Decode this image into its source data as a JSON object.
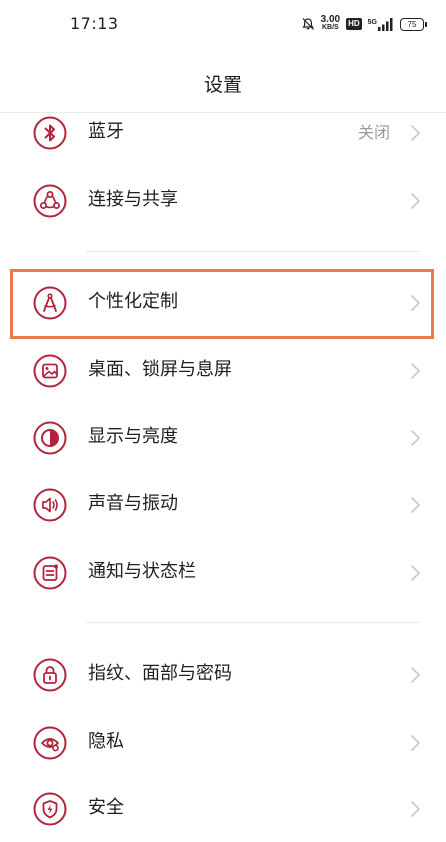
{
  "status_bar": {
    "time": "17:13",
    "net_speed_value": "3.00",
    "net_speed_unit": "KB/S",
    "hd_label": "HD",
    "network_label": "5G",
    "battery_level": "75"
  },
  "header": {
    "title": "设置"
  },
  "theme": {
    "accent": "#b3243c",
    "highlight_border": "#ee7a4c",
    "label_color": "#1f1f1f",
    "secondary_text": "#9a9a9a",
    "chevron_color": "#c8c8c8"
  },
  "settings": [
    {
      "label": "蓝牙",
      "value": "关闭",
      "icon": "bluetooth-icon"
    },
    {
      "label": "连接与共享",
      "value": "",
      "icon": "share-connections-icon"
    },
    {
      "label": "个性化定制",
      "value": "",
      "icon": "compass-personalize-icon",
      "highlighted": true
    },
    {
      "label": "桌面、锁屏与息屏",
      "value": "",
      "icon": "wallpaper-icon"
    },
    {
      "label": "显示与亮度",
      "value": "",
      "icon": "brightness-icon"
    },
    {
      "label": "声音与振动",
      "value": "",
      "icon": "sound-vibration-icon"
    },
    {
      "label": "通知与状态栏",
      "value": "",
      "icon": "notification-icon"
    },
    {
      "label": "指纹、面部与密码",
      "value": "",
      "icon": "lock-icon"
    },
    {
      "label": "隐私",
      "value": "",
      "icon": "privacy-eye-icon"
    },
    {
      "label": "安全",
      "value": "",
      "icon": "security-shield-icon"
    }
  ]
}
